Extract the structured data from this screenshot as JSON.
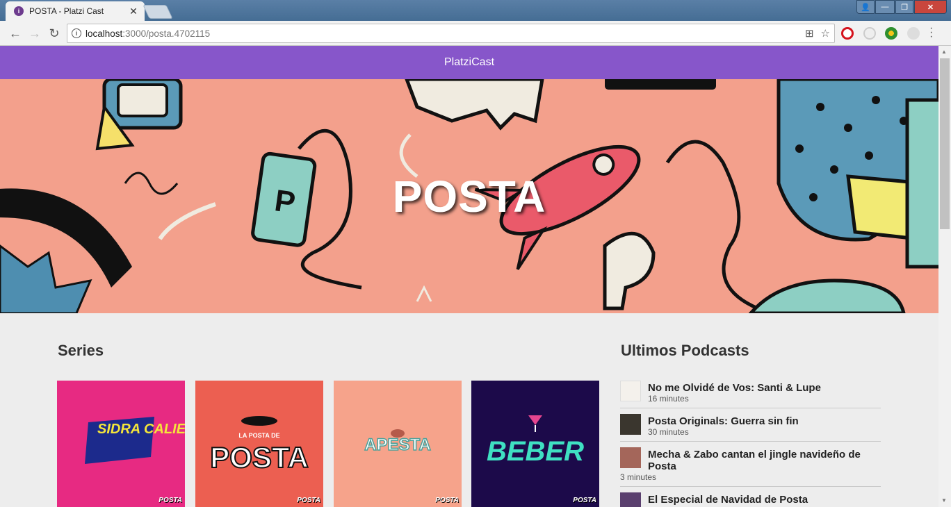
{
  "browser": {
    "tab_title": "POSTA - Platzi Cast",
    "tab_close": "✕",
    "url_host": "localhost",
    "url_path": ":3000/posta.4702115",
    "window_controls": {
      "user": "👤",
      "minimize": "—",
      "maximize": "❐",
      "close": "✕"
    },
    "nav": {
      "back": "←",
      "forward": "→",
      "reload": "↻"
    }
  },
  "app": {
    "title": "PlatziCast",
    "accent_color": "#8756ca"
  },
  "hero": {
    "title": "POSTA",
    "background_color": "#f3a08c"
  },
  "series": {
    "heading": "Series",
    "items": [
      {
        "name": "SIDRA CALIENTE",
        "bg": "#e72a82",
        "badge": "POSTA"
      },
      {
        "name": "POSTA",
        "sub": "LA POSTA DE",
        "bg": "#ec5f51",
        "badge": "POSTA"
      },
      {
        "name": "APESTA",
        "bg": "#f6a38b",
        "badge": "POSTA"
      },
      {
        "name": "BEBER",
        "bg": "#1c0a4a",
        "badge": "POSTA"
      }
    ]
  },
  "podcasts": {
    "heading": "Ultimos Podcasts",
    "items": [
      {
        "title": "No me Olvidé de Vos: Santi & Lupe",
        "duration": "16 minutes"
      },
      {
        "title": "Posta Originals: Guerra sin fin",
        "duration": "30 minutes"
      },
      {
        "title": "Mecha & Zabo cantan el jingle navideño de Posta",
        "duration": "3 minutes"
      },
      {
        "title": "El Especial de Navidad de Posta",
        "duration": ""
      }
    ]
  }
}
